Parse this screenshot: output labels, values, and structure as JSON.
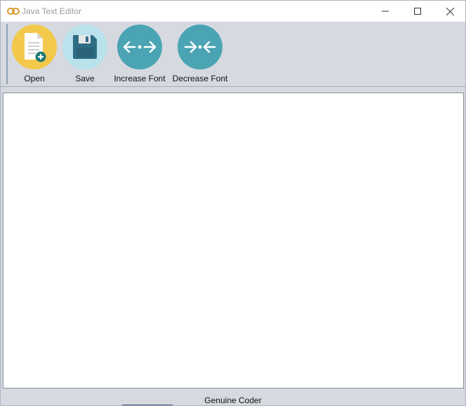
{
  "window": {
    "title": "Java Text Editor",
    "icon": "chain-link-icon"
  },
  "titlebar_buttons": {
    "minimize": "minimize-icon",
    "maximize": "maximize-icon",
    "close": "close-icon"
  },
  "toolbar": {
    "items": [
      {
        "label": "Open",
        "icon": "document-add-icon",
        "color": "#f3c94b"
      },
      {
        "label": "Save",
        "icon": "floppy-disk-icon",
        "color": "#b9e2ec"
      },
      {
        "label": "Increase Font",
        "icon": "expand-arrows-icon",
        "color": "#4aa4b3"
      },
      {
        "label": "Decrease Font",
        "icon": "collapse-arrows-icon",
        "color": "#4aa4b3"
      }
    ]
  },
  "editor": {
    "value": ""
  },
  "statusbar": {
    "text": "Genuine Coder"
  }
}
